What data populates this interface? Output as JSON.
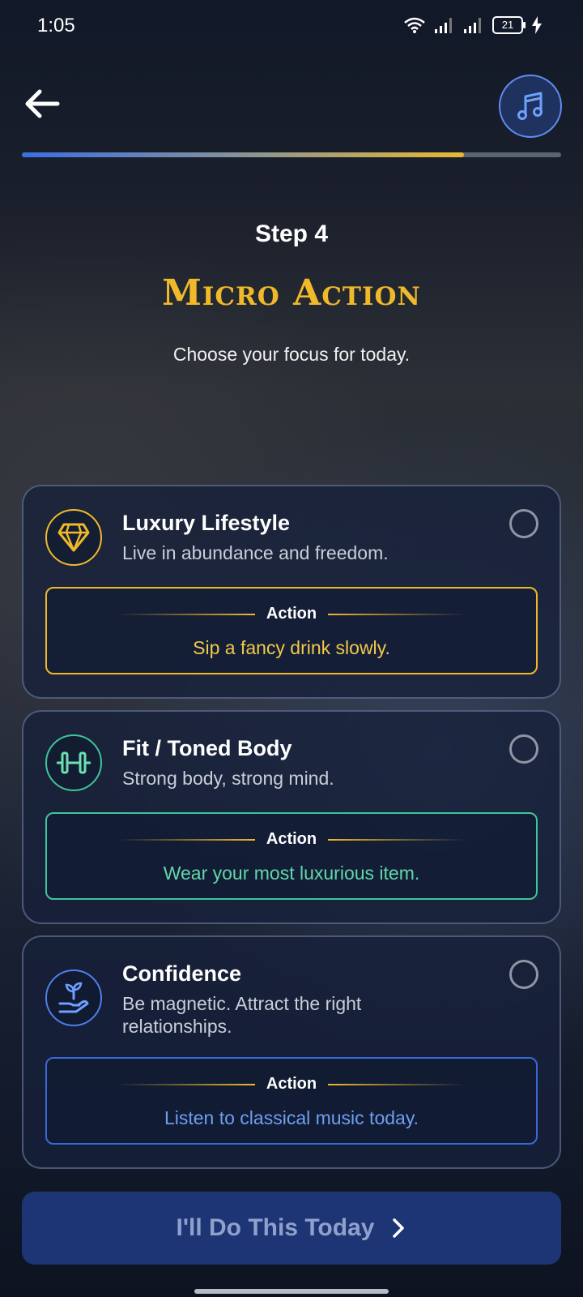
{
  "status_bar": {
    "time": "1:05",
    "battery": "21"
  },
  "header": {
    "back_icon": "arrow-left-icon",
    "music_icon": "music-note-icon",
    "progress": 0.82
  },
  "step_label": "Step 4",
  "title": "Micro Action",
  "subtitle": "Choose your focus for today.",
  "colors": {
    "gold": "#f0b92a",
    "green": "#3ec59a",
    "blue": "#4f80e8",
    "cta_bg": "#1d3575"
  },
  "options": [
    {
      "title": "Luxury Lifestyle",
      "description": "Live in abundance and freedom.",
      "icon": "diamond-icon",
      "action_label": "Action",
      "action_text": "Sip a fancy drink slowly.",
      "selected": false
    },
    {
      "title": "Fit / Toned Body",
      "description": "Strong body, strong mind.",
      "icon": "dumbbell-icon",
      "action_label": "Action",
      "action_text": "Wear your most luxurious item.",
      "selected": false
    },
    {
      "title": "Confidence",
      "description": "Be magnetic. Attract the right relationships.",
      "icon": "hand-sprout-icon",
      "action_label": "Action",
      "action_text": "Listen to classical music today.",
      "selected": false
    }
  ],
  "cta": {
    "label": "I'll Do This Today",
    "icon": "chevron-right-icon"
  }
}
